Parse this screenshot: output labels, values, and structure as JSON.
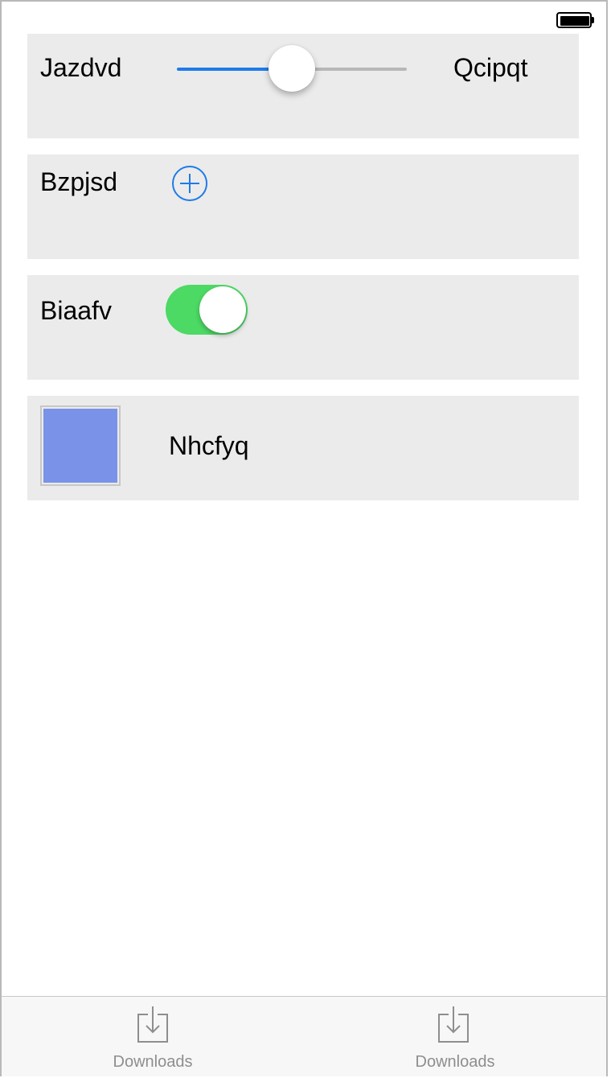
{
  "status_bar": {
    "battery_icon": "battery-full-icon"
  },
  "rows": {
    "slider": {
      "min_label": "Jazdvd",
      "max_label": "Qcipqt",
      "value": 0.5,
      "track_color": "#1e7bea"
    },
    "add": {
      "label": "Bzpjsd",
      "icon": "plus-circle-icon"
    },
    "toggle": {
      "label": "Biaafv",
      "on": true,
      "on_color": "#4cd964"
    },
    "color": {
      "label": "Nhcfyq",
      "swatch_color": "#7a93e8"
    }
  },
  "tabbar": {
    "tabs": [
      {
        "label": "Downloads",
        "icon": "download-icon"
      },
      {
        "label": "Downloads",
        "icon": "download-icon"
      }
    ]
  }
}
